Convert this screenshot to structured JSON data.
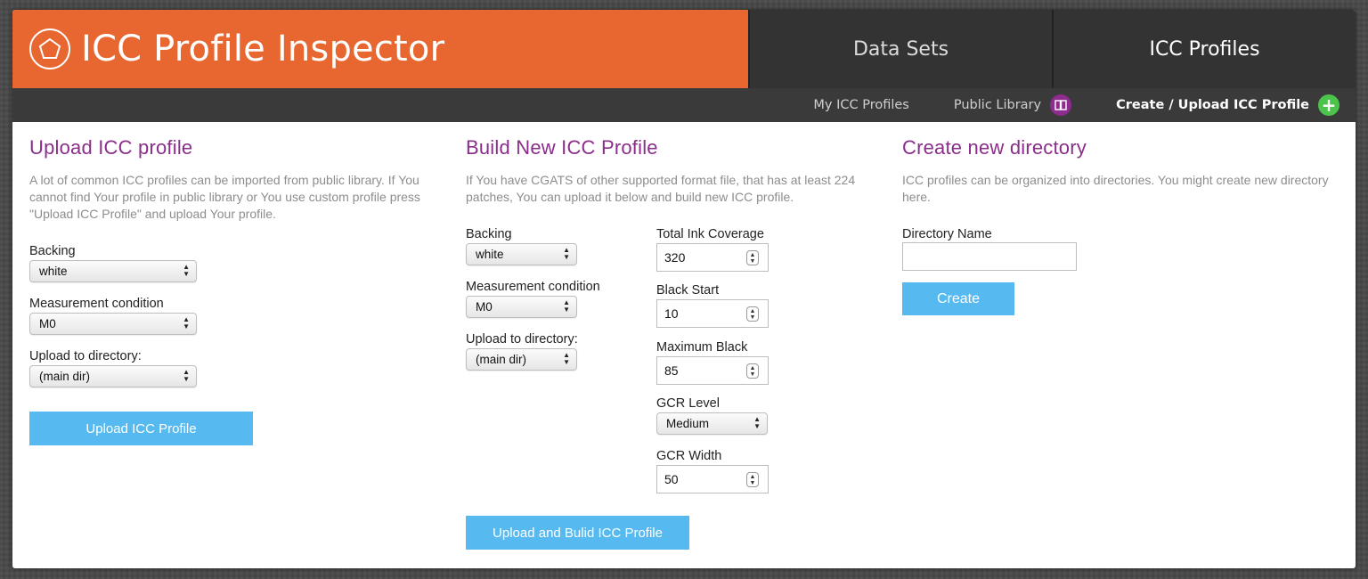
{
  "app": {
    "title": "ICC Profile Inspector",
    "accent": "#e8662f",
    "heading_color": "#8a2e8a",
    "button_color": "#56baf0"
  },
  "tabs": [
    {
      "label": "Data Sets"
    },
    {
      "label": "ICC Profiles"
    }
  ],
  "subnav": {
    "my_profiles": "My ICC Profiles",
    "public_library": "Public Library",
    "public_library_icon": "book-icon",
    "create_upload": "Create / Upload ICC Profile",
    "create_upload_icon": "plus-icon"
  },
  "upload": {
    "title": "Upload ICC profile",
    "description": "A lot of common ICC profiles can be imported from public library. If You cannot find Your profile in public library or You use custom profile press \"Upload ICC Profile\" and upload Your profile.",
    "backing_label": "Backing",
    "backing_value": "white",
    "measurement_label": "Measurement condition",
    "measurement_value": "M0",
    "directory_label": "Upload to directory:",
    "directory_value": "(main dir)",
    "button": "Upload ICC Profile"
  },
  "build": {
    "title": "Build New ICC Profile",
    "description": "If You have CGATS of other supported format file, that has at least 224 patches, You can upload it below and build new ICC profile.",
    "backing_label": "Backing",
    "backing_value": "white",
    "measurement_label": "Measurement condition",
    "measurement_value": "M0",
    "directory_label": "Upload to directory:",
    "directory_value": "(main dir)",
    "tic_label": "Total Ink Coverage",
    "tic_value": "320",
    "black_start_label": "Black Start",
    "black_start_value": "10",
    "max_black_label": "Maximum Black",
    "max_black_value": "85",
    "gcr_level_label": "GCR Level",
    "gcr_level_value": "Medium",
    "gcr_width_label": "GCR Width",
    "gcr_width_value": "50",
    "button": "Upload and Bulid ICC Profile"
  },
  "directory": {
    "title": "Create new directory",
    "description": "ICC profiles can be organized into directories. You might create new directory here.",
    "name_label": "Directory Name",
    "name_value": "",
    "button": "Create"
  }
}
